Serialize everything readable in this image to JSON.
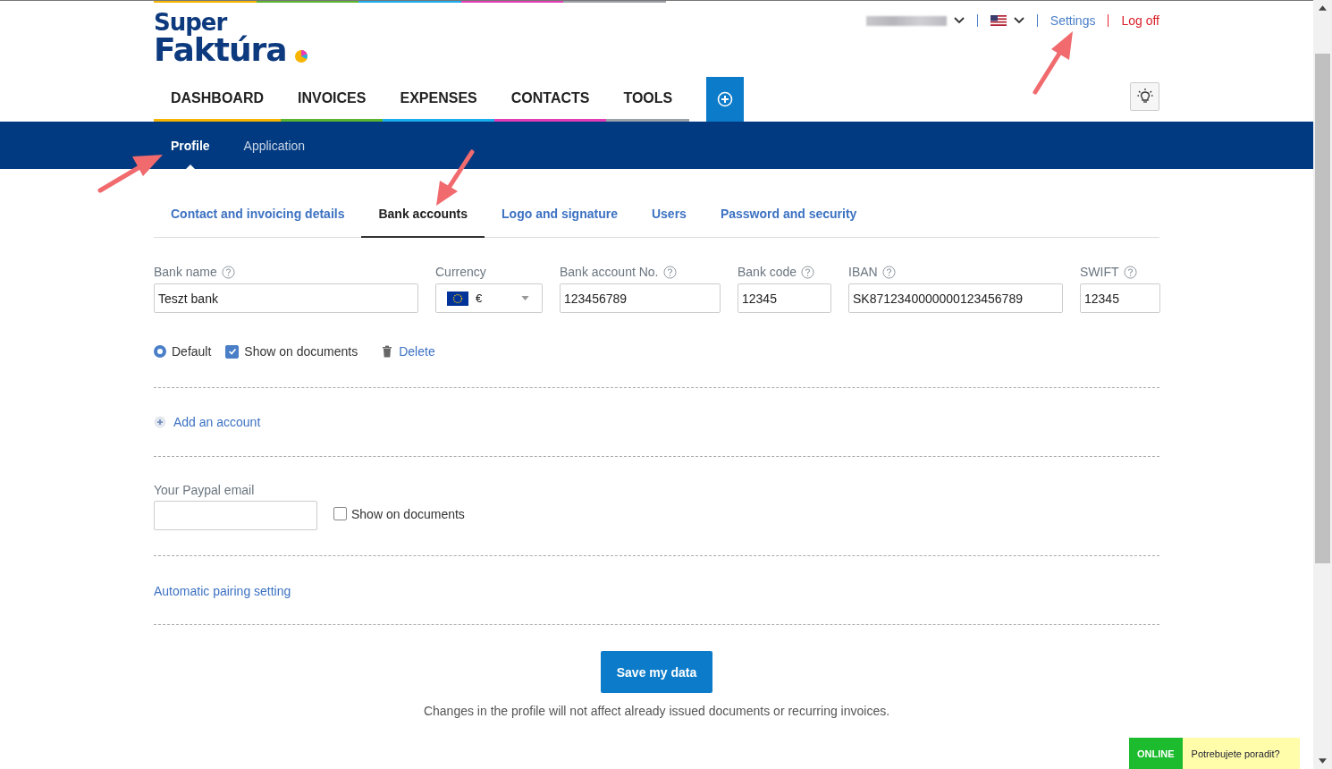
{
  "logo": {
    "line1": "Super",
    "line2": "Faktúra"
  },
  "topbar": {
    "settings": "Settings",
    "logoff": "Log off"
  },
  "nav": [
    {
      "label": "DASHBOARD",
      "color": "#f5b400"
    },
    {
      "label": "INVOICES",
      "color": "#5bb531"
    },
    {
      "label": "EXPENSES",
      "color": "#1aaeef"
    },
    {
      "label": "CONTACTS",
      "color": "#e53bb5"
    },
    {
      "label": "TOOLS",
      "color": "#9aa1a8"
    }
  ],
  "subnav": [
    {
      "label": "Profile",
      "selected": true
    },
    {
      "label": "Application",
      "selected": false
    }
  ],
  "tabs": [
    {
      "label": "Contact and invoicing details",
      "selected": false
    },
    {
      "label": "Bank accounts",
      "selected": true
    },
    {
      "label": "Logo and signature",
      "selected": false
    },
    {
      "label": "Users",
      "selected": false
    },
    {
      "label": "Password and security",
      "selected": false
    }
  ],
  "account": {
    "fields": [
      {
        "kind": "text",
        "label": "Bank name",
        "help": true,
        "value": "Teszt bank"
      },
      {
        "kind": "currency",
        "label": "Currency",
        "help": false,
        "value": "€"
      },
      {
        "kind": "text",
        "label": "Bank account No.",
        "help": true,
        "value": "123456789"
      },
      {
        "kind": "text",
        "label": "Bank code",
        "help": true,
        "value": "12345"
      },
      {
        "kind": "text",
        "label": "IBAN",
        "help": true,
        "value": "SK8712340000000123456789"
      },
      {
        "kind": "text",
        "label": "SWIFT",
        "help": true,
        "value": "12345"
      }
    ],
    "default": {
      "label": "Default",
      "selected": true
    },
    "show_on_documents": {
      "label": "Show on documents",
      "checked": true
    },
    "delete": "Delete"
  },
  "add_account": "Add an account",
  "paypal": {
    "label": "Your Paypal email",
    "show_on_documents": {
      "label": "Show on documents",
      "checked": false
    }
  },
  "auto_pairing": "Automatic pairing setting",
  "save": "Save my data",
  "note": "Changes in the profile will not affect already issued documents or recurring invoices.",
  "chat": {
    "status": "ONLINE",
    "prompt": "Potrebujete poradit?"
  }
}
